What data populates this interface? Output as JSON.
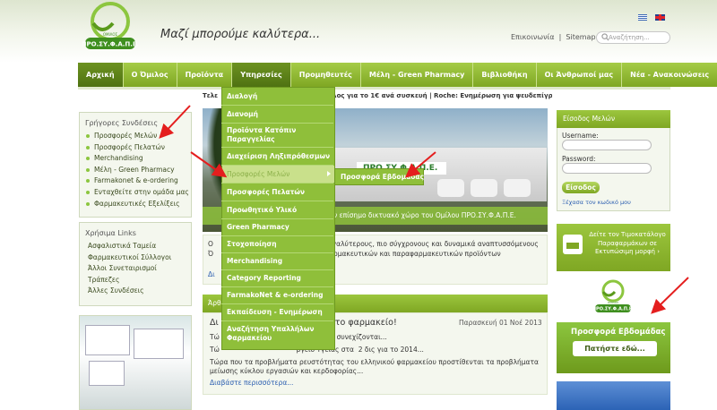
{
  "header": {
    "slogan": "Μαζί μπορούμε καλύτερα...",
    "links": [
      "Επικοινωνία",
      "Sitemap"
    ],
    "separator": "|",
    "search_placeholder": "Αναζήτηση...",
    "logo_text": "ΠΡΟ.ΣΥ.Φ.Α.Π.Ε.",
    "logo_sub": "ΟΜΙΛΟΣ"
  },
  "nav": {
    "items": [
      "Αρχική",
      "Ο Όμιλος",
      "Προϊόντα",
      "Υπηρεσίες",
      "Προμηθευτές",
      "Μέλη - Green Pharmacy",
      "Βιβλιοθήκη",
      "Οι Άνθρωποί μας",
      "Νέα - Ανακοινώσεις"
    ],
    "active": "Αρχική",
    "open": "Υπηρεσίες"
  },
  "ticker": {
    "prefix": "Τελε",
    "text": "κίλος για το 1€ ανά συσκευή  |  Roche: Ενημέρωση για ψευδεπίγραφ"
  },
  "dropdown": {
    "items": [
      "Διαλογή",
      "Διανομή",
      "Προϊόντα Κατόπιν Παραγγελίας",
      "Διαχείριση Ληξιπρόθεσμων",
      "Προσφορές Μελών",
      "Προσφορές Πελατών",
      "Προωθητικό Υλικό",
      "Green Pharmacy",
      "Στοχοποίηση",
      "Merchandising",
      "Category Reporting",
      "FarmakoNet & e-ordering",
      "Εκπαίδευση - Ενημέρωση",
      "Αναζήτηση Υπαλλήλων Φαρμακείου"
    ],
    "submenu": "Προσφορά Εβδομάδας"
  },
  "sidebar": {
    "quick_title": "Γρήγορες Συνδέσεις",
    "quick_links": [
      "Προσφορές Μελών",
      "Προσφορές Πελατών",
      "Merchandising",
      "Μέλη - Green Pharmacy",
      "Farmakonet & e-ordering",
      "Ενταχθείτε στην ομάδα μας",
      "Φαρμακευτικές Εξελίξεις"
    ],
    "useful_title": "Χρήσιμα Links",
    "useful_links": [
      "Ασφαλιστικά Ταμεία",
      "Φαρμακευτικοί Σύλλογοι",
      "Άλλοι Συνεταιρισμοί",
      "Τράπεζες",
      "Άλλες Συνδέσεις"
    ]
  },
  "hero": {
    "sign": "ΠΡΟ.ΣΥ.Φ.Α.Π.Ε.",
    "caption": "ν επίσημο δικτυακό χώρο του Ομίλου ΠΡΟ.ΣΥ.Φ.Α.Π.Ε."
  },
  "intro": {
    "line1": "Ο                                                    μεγαλύτερους, πιο σύγχρονους και δυναμικά αναπτυσσόμενους",
    "line2": "Ό                                                    φαρμακευτικών και παραφαρμακευτικών προϊόντων",
    "more": "Δι"
  },
  "articles": {
    "title": "Άρθ",
    "headline": "Δι                                      α στο φαρμακείο!",
    "date": "Παρασκευή 01 Νοέ 2013",
    "l1": "Τώ                                    ικονομικών συνεχίζονται...",
    "l2": "Τώ                                    ργείο Υγείας στα  2 δις για το 2014...",
    "l3": "Τώρα που τα προβλήματα ρευστότητας του ελληνικού φαρμακείου προστίθενται τα προβλήματα μείωσης κύκλου εργασιών και κερδοφορίας...",
    "more": "Διαβάστε περισσότερα..."
  },
  "login": {
    "title": "Είσοδος Μελών",
    "username_label": "Username:",
    "password_label": "Password:",
    "button": "Είσοδος",
    "forgot": "Ξέχασα τον κωδικό μου"
  },
  "pricelist": {
    "text": "Δείτε τον Τιμοκατάλογο Παραφαρμάκων σε Εκτυπώσιμη μορφή ›"
  },
  "weekly": {
    "title": "Προσφορά Εβδομάδας",
    "button": "Πατήστε εδώ...",
    "logo_sub": "ΟΜΙΛΟΣ",
    "logo_text": "ΠΡΟ.ΣΥ.Φ.Α.Π.Ε."
  },
  "colors": {
    "brand_green": "#8cc63f",
    "nav_green": "#7fa723",
    "active_nav": "#4f7212",
    "link_blue": "#2a5db0",
    "arrow_red": "#e41e1e"
  }
}
